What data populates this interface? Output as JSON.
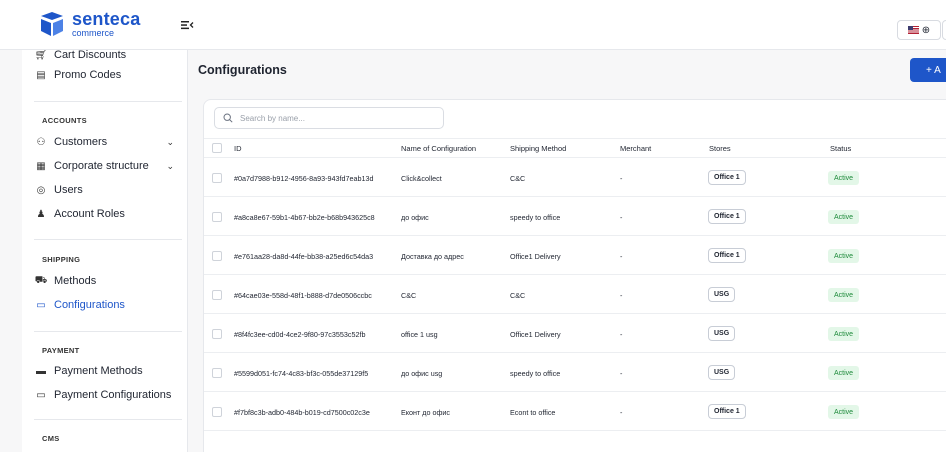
{
  "brand": {
    "name": "senteca",
    "sub": "commerce",
    "color": "#1e56c9"
  },
  "topbar": {
    "collapse_icon": "menu-collapse-icon",
    "language_icon": "globe-icon",
    "language_flag": "us-flag"
  },
  "sidebar": {
    "items_top": [
      {
        "label": "Cart Discounts",
        "icon": "cart-icon"
      },
      {
        "label": "Promo Codes",
        "icon": "ticket-icon"
      }
    ],
    "sections": [
      {
        "title": "ACCOUNTS",
        "items": [
          {
            "label": "Customers",
            "icon": "users-icon",
            "expandable": true
          },
          {
            "label": "Corporate structure",
            "icon": "building-icon",
            "expandable": true
          },
          {
            "label": "Users",
            "icon": "user-circle-icon"
          },
          {
            "label": "Account Roles",
            "icon": "user-role-icon"
          }
        ]
      },
      {
        "title": "SHIPPING",
        "items": [
          {
            "label": "Methods",
            "icon": "truck-icon"
          },
          {
            "label": "Configurations",
            "icon": "config-icon",
            "active": true
          }
        ]
      },
      {
        "title": "PAYMENT",
        "items": [
          {
            "label": "Payment Methods",
            "icon": "wallet-icon"
          },
          {
            "label": "Payment Configurations",
            "icon": "credit-card-icon"
          }
        ]
      },
      {
        "title": "CMS",
        "items": []
      }
    ]
  },
  "main": {
    "title": "Configurations",
    "add_label": "+ A",
    "search_placeholder": "Search by name...",
    "columns": [
      "ID",
      "Name of Configuration",
      "Shipping Method",
      "Merchant",
      "Stores",
      "Status"
    ],
    "rows": [
      {
        "id": "#0a7d7988-b912-4956-8a93-943fd7eab13d",
        "name": "Click&collect",
        "method": "C&C",
        "merchant": "-",
        "store": "Office 1",
        "status": "Active"
      },
      {
        "id": "#a8ca8e67-59b1-4b67-bb2e-b68b943625c8",
        "name": "до офис",
        "method": "speedy to office",
        "merchant": "-",
        "store": "Office 1",
        "status": "Active"
      },
      {
        "id": "#e761aa28-da8d-44fe-bb38-a25ed6c54da3",
        "name": "Доставка до адрес",
        "method": "Office1 Delivery",
        "merchant": "-",
        "store": "Office 1",
        "status": "Active"
      },
      {
        "id": "#64cae03e-558d-48f1-b888-d7de0506ccbc",
        "name": "C&C",
        "method": "C&C",
        "merchant": "-",
        "store": "USG",
        "status": "Active"
      },
      {
        "id": "#8f4fc3ee-cd0d-4ce2-9f80-97c3553c52fb",
        "name": "office 1 usg",
        "method": "Office1 Delivery",
        "merchant": "-",
        "store": "USG",
        "status": "Active"
      },
      {
        "id": "#5599d051-fc74-4c83-bf3c-055de37129f5",
        "name": "до офис usg",
        "method": "speedy to office",
        "merchant": "-",
        "store": "USG",
        "status": "Active"
      },
      {
        "id": "#f7bf8c3b-adb0-484b-b019-cd7500c02c3e",
        "name": "Еконт до офис",
        "method": "Econt to office",
        "merchant": "-",
        "store": "Office 1",
        "status": "Active"
      }
    ]
  }
}
